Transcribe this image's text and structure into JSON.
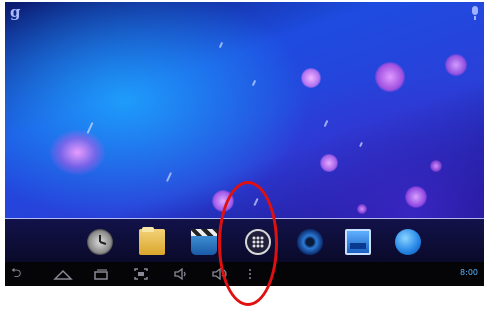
{
  "status_bar": {
    "search_glyph": "g",
    "mic_icon": "mic-icon"
  },
  "dock": {
    "apps": [
      {
        "name": "clock-app-icon"
      },
      {
        "name": "file-manager-app-icon"
      },
      {
        "name": "video-player-app-icon"
      },
      {
        "name": "all-apps-launcher-icon"
      },
      {
        "name": "music-player-app-icon"
      },
      {
        "name": "gallery-app-icon"
      },
      {
        "name": "browser-app-icon"
      }
    ]
  },
  "nav_bar": {
    "buttons": [
      "back-icon",
      "home-icon",
      "recent-apps-icon",
      "screenshot-icon",
      "volume-down-icon",
      "volume-up-icon",
      "menu-icon"
    ],
    "clock": "8:00"
  },
  "colors": {
    "annotation_circle": "#e01010",
    "clock_text": "#5ab4ff"
  }
}
